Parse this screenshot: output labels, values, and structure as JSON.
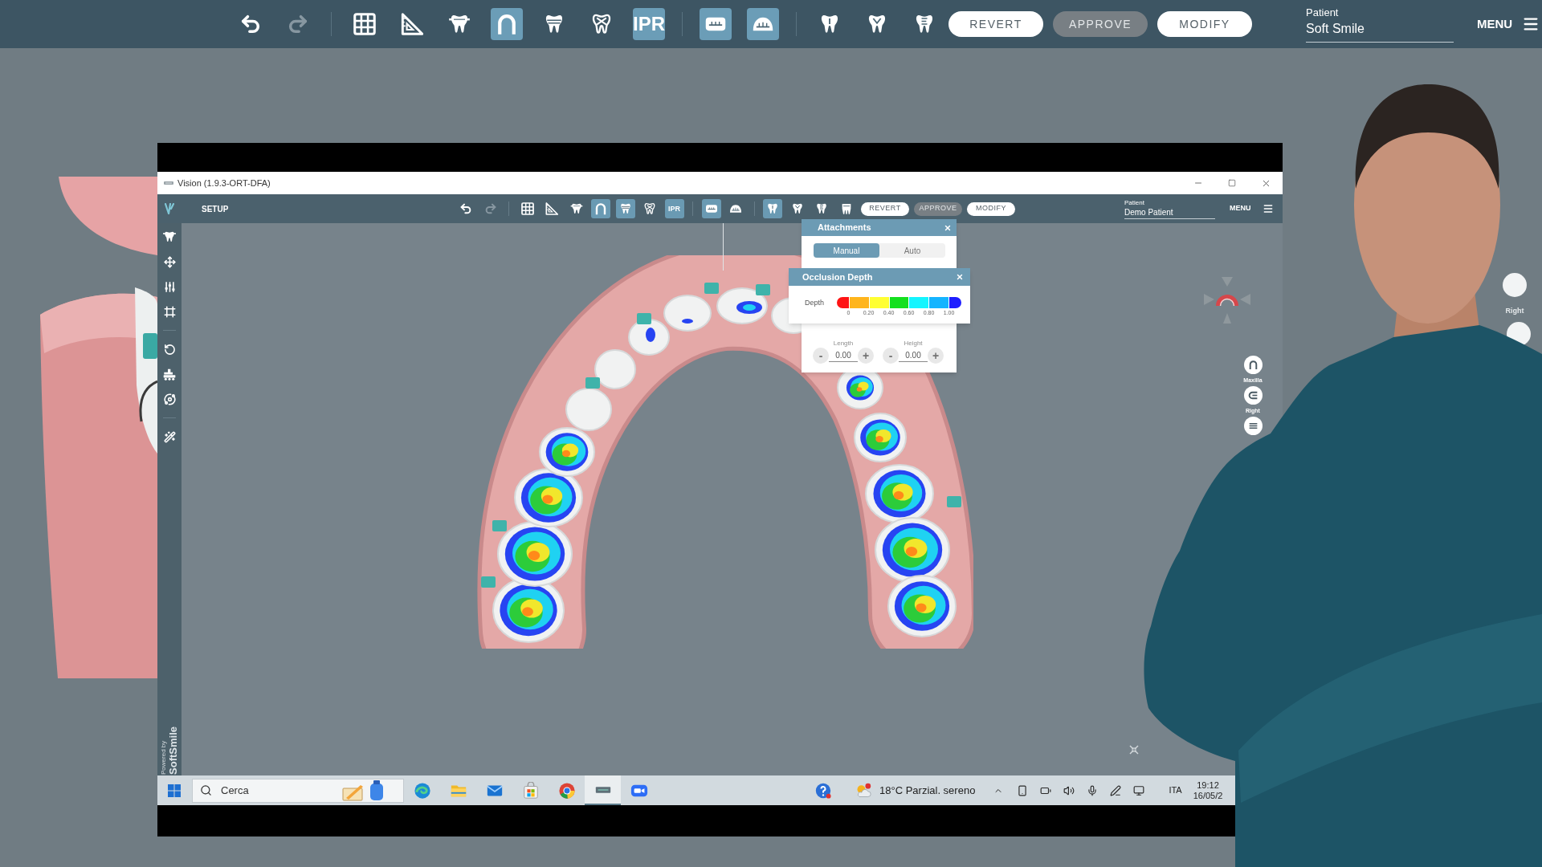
{
  "top_bar": {
    "history": [
      {
        "kind": "undo",
        "disabled": false
      },
      {
        "kind": "redo",
        "disabled": true
      }
    ],
    "tool_groups": [
      [
        {
          "kind": "grid",
          "selected": false
        },
        {
          "kind": "set_square",
          "selected": false
        },
        {
          "kind": "tooth_crown",
          "selected": false
        },
        {
          "kind": "arch",
          "selected": true
        },
        {
          "kind": "tooth_band",
          "selected": false
        },
        {
          "kind": "tooth_cross",
          "selected": false
        },
        {
          "kind": "ipr",
          "label": "IPR",
          "selected": true
        }
      ],
      [
        {
          "kind": "lower_tray",
          "selected": true
        },
        {
          "kind": "upper_tray",
          "selected": true
        }
      ],
      [
        {
          "kind": "tooth_front",
          "selected": false
        },
        {
          "kind": "tooth_side",
          "selected": false
        },
        {
          "kind": "tooth_back",
          "selected": false
        }
      ]
    ],
    "buttons": [
      {
        "label": "REVERT",
        "disabled": false
      },
      {
        "label": "APPROVE",
        "disabled": true
      },
      {
        "label": "MODIFY",
        "disabled": false
      }
    ],
    "patient": {
      "label": "Patient",
      "name": "Soft Smile"
    },
    "menu": "MENU"
  },
  "window": {
    "title": "Vision (1.9.3-ORT-DFA)",
    "toolbar": {
      "mode": "SETUP",
      "history": [
        {
          "kind": "undo",
          "disabled": false
        },
        {
          "kind": "redo",
          "disabled": true
        }
      ],
      "tool_groups": [
        [
          {
            "kind": "grid",
            "selected": false
          },
          {
            "kind": "set_square",
            "selected": false
          },
          {
            "kind": "tooth_crown",
            "selected": false
          },
          {
            "kind": "arch",
            "selected": true
          },
          {
            "kind": "tooth_band",
            "selected": true
          },
          {
            "kind": "tooth_cross",
            "selected": false
          },
          {
            "kind": "ipr",
            "label": "IPR",
            "selected": true
          }
        ],
        [
          {
            "kind": "lower_tray",
            "selected": true
          },
          {
            "kind": "upper_tray",
            "selected": false
          }
        ],
        [
          {
            "kind": "tooth_front",
            "selected": true
          },
          {
            "kind": "tooth_side",
            "selected": false
          },
          {
            "kind": "tooth_back",
            "selected": false
          },
          {
            "kind": "tooth_roots",
            "selected": false
          }
        ]
      ],
      "buttons": [
        {
          "label": "REVERT",
          "disabled": false
        },
        {
          "label": "APPROVE",
          "disabled": true
        },
        {
          "label": "MODIFY",
          "disabled": false
        }
      ],
      "patient": {
        "label": "Patient",
        "name": "Demo Patient"
      },
      "menu": "MENU"
    },
    "branding": {
      "prefix": "Powered by",
      "name": "SoftSmile"
    },
    "attachments_panel": {
      "title": "Attachments",
      "modes": [
        {
          "label": "Manual",
          "selected": true
        },
        {
          "label": "Auto",
          "selected": false
        }
      ],
      "fields": [
        {
          "label": "Length",
          "value": "0.00",
          "decrement": "-",
          "increment": "+"
        },
        {
          "label": "Height",
          "value": "0.00",
          "decrement": "-",
          "increment": "+"
        }
      ]
    },
    "occlusion_depth_panel": {
      "title": "Occlusion Depth",
      "label": "Depth",
      "scale": [
        {
          "color": "#ff1414"
        },
        {
          "color": "#ffb51c"
        },
        {
          "color": "#ffff33"
        },
        {
          "color": "#14e01e"
        },
        {
          "color": "#14f5ff"
        },
        {
          "color": "#14b4ff"
        },
        {
          "color": "#1e1eff"
        }
      ],
      "ticks": [
        "0",
        "0.20",
        "0.40",
        "0.60",
        "0.80",
        "1.00"
      ]
    },
    "view_buttons": [
      {
        "kind": "arch",
        "label": "Maxilla"
      },
      {
        "kind": "side",
        "label": "Right"
      },
      {
        "kind": "front"
      }
    ]
  },
  "taskbar": {
    "search": {
      "placeholder": "Cerca"
    },
    "apps": [
      {
        "kind": "swirl",
        "active": false
      },
      {
        "kind": "folder",
        "active": false
      },
      {
        "kind": "mail",
        "active": false
      },
      {
        "kind": "store",
        "active": false
      },
      {
        "kind": "ball",
        "active": false
      },
      {
        "kind": "window",
        "active": true
      },
      {
        "kind": "video",
        "active": false
      }
    ],
    "weather": "18°C Parzial. sereno",
    "language": "ITA",
    "time": "19:12",
    "date": "16/05/2"
  },
  "background_view_buttons": [
    {
      "label": "Right"
    }
  ]
}
